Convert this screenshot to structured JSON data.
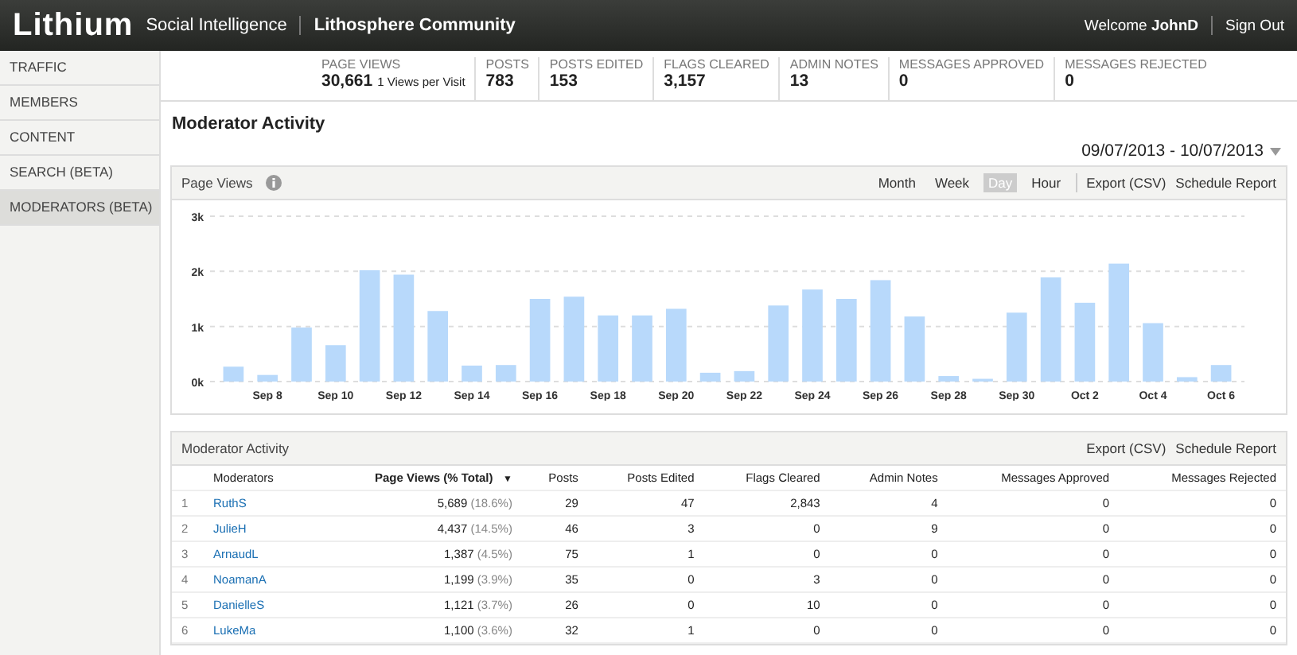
{
  "header": {
    "logo": "Lithium",
    "product": "Social Intelligence",
    "community": "Lithosphere Community",
    "welcome": "Welcome",
    "user": "JohnD",
    "sign_out": "Sign Out"
  },
  "sidebar": {
    "items": [
      {
        "label": "TRAFFIC",
        "selected": false
      },
      {
        "label": "MEMBERS",
        "selected": false
      },
      {
        "label": "CONTENT",
        "selected": false
      },
      {
        "label": "SEARCH (BETA)",
        "selected": false
      },
      {
        "label": "MODERATORS (BETA)",
        "selected": true
      }
    ]
  },
  "stats": [
    {
      "label": "PAGE VIEWS",
      "value": "30,661",
      "note": "1 Views per Visit"
    },
    {
      "label": "POSTS",
      "value": "783"
    },
    {
      "label": "POSTS EDITED",
      "value": "153"
    },
    {
      "label": "FLAGS CLEARED",
      "value": "3,157"
    },
    {
      "label": "ADMIN NOTES",
      "value": "13"
    },
    {
      "label": "MESSAGES APPROVED",
      "value": "0"
    },
    {
      "label": "MESSAGES REJECTED",
      "value": "0"
    }
  ],
  "page_title": "Moderator Activity",
  "date_range": "09/07/2013 - 10/07/2013",
  "chart_panel": {
    "title": "Page Views",
    "periods": [
      {
        "label": "Month",
        "selected": false
      },
      {
        "label": "Week",
        "selected": false
      },
      {
        "label": "Day",
        "selected": true
      },
      {
        "label": "Hour",
        "selected": false
      }
    ],
    "actions": [
      "Export (CSV)",
      "Schedule Report"
    ],
    "chart_data": {
      "type": "bar",
      "categories": [
        null,
        "Sep 8",
        null,
        "Sep 10",
        null,
        "Sep 12",
        null,
        "Sep 14",
        null,
        "Sep 16",
        null,
        "Sep 18",
        null,
        "Sep 20",
        null,
        "Sep 22",
        null,
        "Sep 24",
        null,
        "Sep 26",
        null,
        "Sep 28",
        null,
        "Sep 30",
        null,
        "Oct 2",
        null,
        "Oct 4",
        null,
        "Oct 6"
      ],
      "series": [
        {
          "color": "#b8d9fb",
          "values": [
            270,
            120,
            980,
            660,
            2020,
            1940,
            1280,
            290,
            300,
            1500,
            1540,
            1200,
            1200,
            1320,
            160,
            190,
            1380,
            1670,
            1500,
            1840,
            1180,
            100,
            50,
            1250,
            1890,
            1430,
            2140,
            1060,
            80,
            300
          ]
        }
      ],
      "ylim": [
        0,
        3000
      ],
      "yticks": [
        {
          "value": 0,
          "label": "0k"
        },
        {
          "value": 1000,
          "label": "1k"
        },
        {
          "value": 2000,
          "label": "2k"
        },
        {
          "value": 3000,
          "label": "3k"
        }
      ]
    }
  },
  "table_panel": {
    "title": "Moderator Activity",
    "actions": [
      "Export (CSV)",
      "Schedule Report"
    ],
    "columns": [
      "Moderators",
      "Page Views (% Total)",
      "Posts",
      "Posts Edited",
      "Flags Cleared",
      "Admin Notes",
      "Messages Approved",
      "Messages Rejected"
    ],
    "sort_icon": "▼",
    "rows": [
      {
        "rank": "1",
        "share": "(18.6%)",
        "cells": [
          "RuthS",
          "5,689",
          "29",
          "47",
          "2,843",
          "4",
          "0",
          "0"
        ]
      },
      {
        "rank": "2",
        "share": "(14.5%)",
        "cells": [
          "JulieH",
          "4,437",
          "46",
          "3",
          "0",
          "9",
          "0",
          "0"
        ]
      },
      {
        "rank": "3",
        "share": "(4.5%)",
        "cells": [
          "ArnaudL",
          "1,387",
          "75",
          "1",
          "0",
          "0",
          "0",
          "0"
        ]
      },
      {
        "rank": "4",
        "share": "(3.9%)",
        "cells": [
          "NoamanA",
          "1,199",
          "35",
          "0",
          "3",
          "0",
          "0",
          "0"
        ]
      },
      {
        "rank": "5",
        "share": "(3.7%)",
        "cells": [
          "DanielleS",
          "1,121",
          "26",
          "0",
          "10",
          "0",
          "0",
          "0"
        ]
      },
      {
        "rank": "6",
        "share": "(3.6%)",
        "cells": [
          "LukeMa",
          "1,100",
          "32",
          "1",
          "0",
          "0",
          "0",
          "0"
        ]
      }
    ]
  }
}
